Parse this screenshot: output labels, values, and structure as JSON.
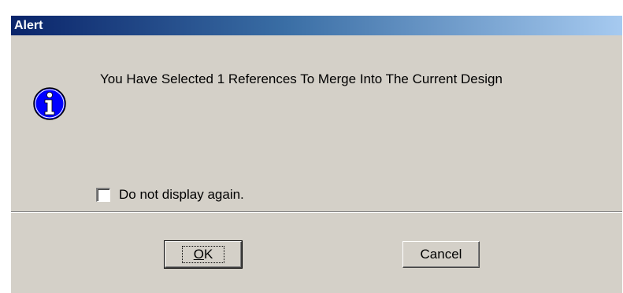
{
  "window": {
    "title": "Alert"
  },
  "dialog": {
    "icon": "info-icon",
    "message": "You Have Selected 1 References To Merge Into The Current Design",
    "checkbox": {
      "label": "Do not display again.",
      "checked": false
    }
  },
  "buttons": {
    "ok_mnemonic": "O",
    "ok_rest": "K",
    "cancel_label": "Cancel"
  },
  "colors": {
    "title_start": "#0a246a",
    "title_end": "#a6caf0",
    "face": "#d4d0c8",
    "icon_blue": "#0000ff"
  }
}
